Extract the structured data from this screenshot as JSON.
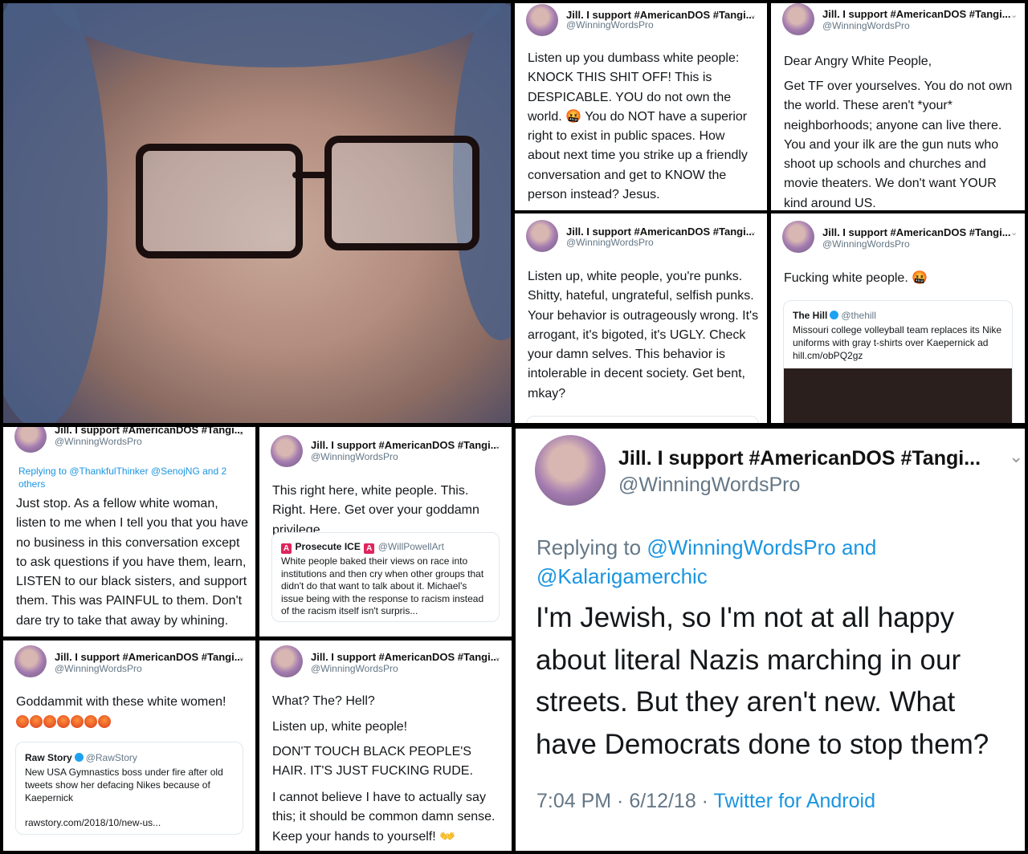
{
  "author": {
    "display_name": "Jill. I support #AmericanDOS #Tangi...",
    "handle": "@WinningWordsPro"
  },
  "tweets": {
    "t1": {
      "text": "Listen up you dumbass white people: KNOCK THIS SHIT OFF! This is DESPICABLE. YOU do not own the world. 🤬 You do NOT have a superior right to exist in public spaces. How about next time you strike up a friendly conversation and get to KNOW the person instead? Jesus."
    },
    "t2": {
      "greeting": "Dear Angry White People,",
      "text": "Get TF over yourselves. You do not own the world. These aren't *your* neighborhoods; anyone can live there. You and your ilk are the gun nuts who shoot up schools and churches and movie theaters. We don't want YOUR kind around US."
    },
    "t3": {
      "text": "Listen up, white people, you're punks. Shitty, hateful, ungrateful, selfish punks. Your behavior is outrageously wrong. It's arrogant, it's bigoted, it's UGLY. Check your damn selves. This behavior is intolerable in decent society. Get bent, mkay?"
    },
    "t4": {
      "text": "Fucking white people. 🤬",
      "card": {
        "name": "The Hill",
        "handle": "@thehill",
        "text": "Missouri college volleyball team replaces its Nike uniforms with gray t-shirts over Kaepernick ad hill.cm/obPQ2gz"
      }
    },
    "t5": {
      "replying": "Replying to @ThankfulThinker @SenojNG and 2 others",
      "text": "Just stop. As a fellow white woman, listen to me when I tell you that you have no business in this conversation except to ask questions if you have them, learn, LISTEN to our black sisters, and support them. This was PAINFUL to them. Don't dare try to take that away by whining."
    },
    "t6": {
      "text": "This right here, white people. This. Right. Here. Get over your goddamn privilege.",
      "card": {
        "name": "Prosecute ICE",
        "badge": "A",
        "handle": "@WillPowellArt",
        "text": "White people baked their views on race into institutions and then cry when other groups that didn't do that want to talk about it. Michael's issue being with the response to racism instead of the racism itself isn't surpris..."
      }
    },
    "t7": {
      "text": "Goddammit with these white women!",
      "emoji_count": 7,
      "card": {
        "name": "Raw Story",
        "handle": "@RawStory",
        "text": "New USA Gymnastics boss under fire after old tweets show her defacing Nikes because of Kaepernick",
        "link": "rawstory.com/2018/10/new-us..."
      }
    },
    "t8": {
      "line1": "What? The? Hell?",
      "line2": "Listen up, white people!",
      "line3": "DON'T TOUCH BLACK PEOPLE'S HAIR. IT'S JUST FUCKING RUDE.",
      "line4": "I cannot believe I have to actually say this; it should be common damn sense. Keep your hands to yourself! 👐"
    },
    "t9": {
      "replying_prefix": "Replying to",
      "replying_to": "@WinningWordsPro and @Kalarigamerchic",
      "text": "I'm Jewish, so I'm not at all happy about literal Nazis marching in our streets. But they aren't new. What have Democrats done to stop them?",
      "time": "7:04 PM · 6/12/18 ·",
      "source": "Twitter for Android"
    }
  },
  "colors": {
    "link": "#1b95e0",
    "handle": "#657786",
    "text": "#14171a"
  }
}
